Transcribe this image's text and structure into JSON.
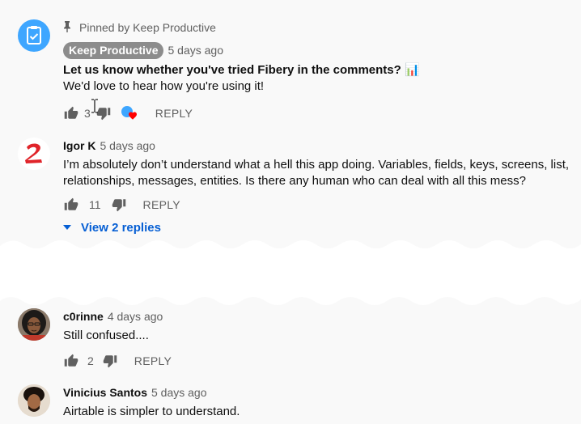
{
  "pinned_comment": {
    "pinned_label": "Pinned by Keep Productive",
    "author": "Keep Productive",
    "time": "5 days ago",
    "text_line1": "Let us know whether you've tried Fibery in the comments? 📊",
    "text_line2": "We'd love to hear how you're using it!",
    "likes": "3",
    "reply_label": "REPLY",
    "avatar_color": "#3ea6ff"
  },
  "comments": [
    {
      "author": "Igor K",
      "time": "5 days ago",
      "text": "I’m absolutely don’t understand what a hell this app doing. Variables, fields, keys, screens, list, relationships, messages, entities. Is there any human who can deal with all this mess?",
      "likes": "11",
      "reply_label": "REPLY",
      "view_replies": "View 2 replies"
    },
    {
      "author": "c0rinne",
      "time": "4 days ago",
      "text": "Still confused....",
      "likes": "2",
      "reply_label": "REPLY"
    },
    {
      "author": "Vinicius Santos",
      "time": "5 days ago",
      "text": "Airtable is simpler to understand."
    }
  ],
  "colors": {
    "link_blue": "#065fd4",
    "heart_red": "#ff0000",
    "background": "#f9f9f9"
  }
}
